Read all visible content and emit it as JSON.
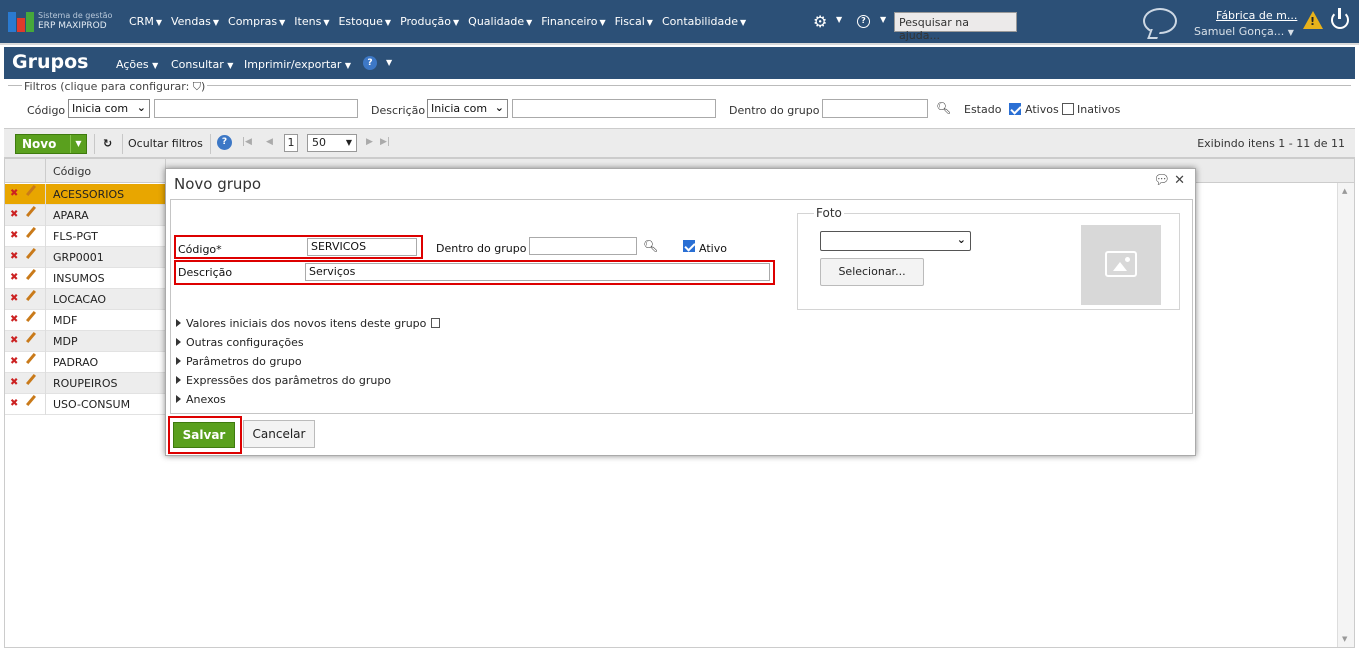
{
  "topbar": {
    "brand_line1": "Sistema de gestão",
    "brand_line2": "ERP MAXIPROD",
    "menu": [
      "CRM",
      "Vendas",
      "Compras",
      "Itens",
      "Estoque",
      "Produção",
      "Qualidade",
      "Financeiro",
      "Fiscal",
      "Contabilidade"
    ],
    "search_placeholder": "Pesquisar na ajuda...",
    "company": "Fábrica de m...",
    "user": "Samuel Gonça...",
    "warn_mark": "!",
    "help_mark": "?"
  },
  "page": {
    "title": "Grupos",
    "menu": [
      "Ações",
      "Consultar",
      "Imprimir/exportar"
    ],
    "help_mark": "?"
  },
  "filters": {
    "legend": "Filtros (clique para configurar:",
    "legend_close": ")",
    "codigo_label": "Código",
    "codigo_mode": "Inicia com",
    "descricao_label": "Descrição",
    "descricao_mode": "Inicia com",
    "grupo_label": "Dentro do grupo",
    "estado_label": "Estado",
    "ativos_label": "Ativos",
    "inativos_label": "Inativos"
  },
  "toolbar": {
    "novo": "Novo",
    "ocultar": "Ocultar filtros",
    "page": "1",
    "page_size": "50",
    "showing": "Exibindo itens 1 - 11 de 11"
  },
  "grid": {
    "col_codigo": "Código",
    "rows": [
      "ACESSORIOS",
      "APARA",
      "FLS-PGT",
      "GRP0001",
      "INSUMOS",
      "LOCACAO",
      "MDF",
      "MDP",
      "PADRAO",
      "ROUPEIROS",
      "USO-CONSUM"
    ]
  },
  "dialog": {
    "title": "Novo grupo",
    "codigo_label": "Código*",
    "codigo_value": "SERVICOS",
    "grupo_label": "Dentro do grupo",
    "ativo_label": "Ativo",
    "descricao_label": "Descrição",
    "descricao_value": "Serviços",
    "foto_label": "Foto",
    "selecionar": "Selecionar...",
    "sections": [
      "Valores iniciais dos novos itens deste grupo",
      "Outras configurações",
      "Parâmetros do grupo",
      "Expressões dos parâmetros do grupo",
      "Anexos"
    ],
    "salvar": "Salvar",
    "cancelar": "Cancelar"
  },
  "colors": {
    "header_bg": "#2c5077",
    "accent_green": "#5aa01e",
    "selected_row": "#e8a600",
    "highlight_red": "#d00000"
  }
}
